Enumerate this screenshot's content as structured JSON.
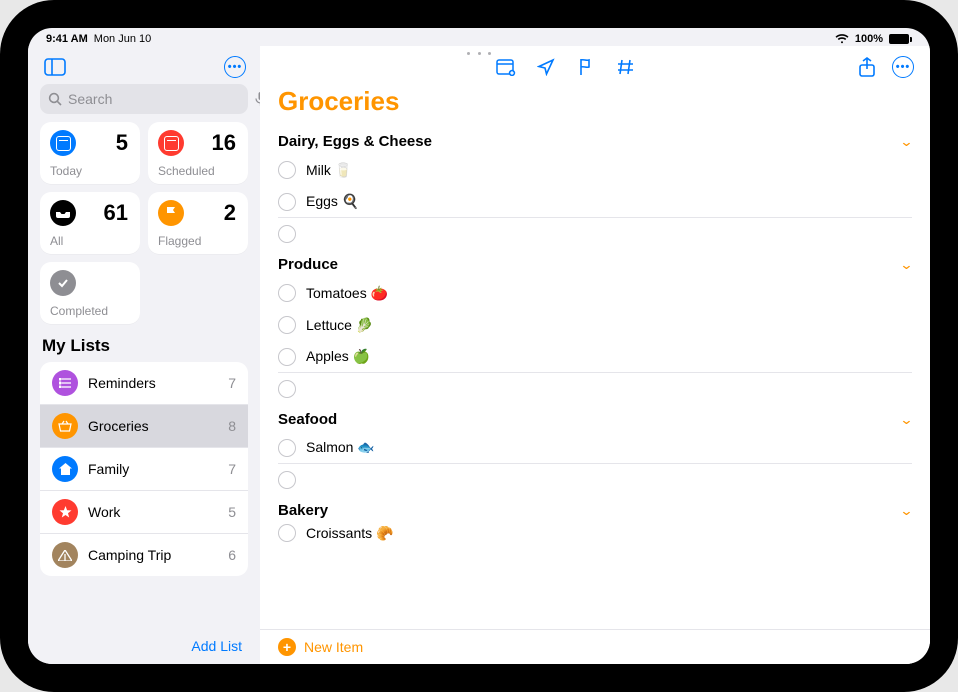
{
  "status": {
    "time": "9:41 AM",
    "date": "Mon Jun 10",
    "battery": "100%"
  },
  "search": {
    "placeholder": "Search"
  },
  "tiles": {
    "today": {
      "label": "Today",
      "count": "5"
    },
    "scheduled": {
      "label": "Scheduled",
      "count": "16"
    },
    "all": {
      "label": "All",
      "count": "61"
    },
    "flagged": {
      "label": "Flagged",
      "count": "2"
    },
    "completed": {
      "label": "Completed"
    }
  },
  "mylists_title": "My Lists",
  "lists": {
    "reminders": {
      "name": "Reminders",
      "count": "7"
    },
    "groceries": {
      "name": "Groceries",
      "count": "8"
    },
    "family": {
      "name": "Family",
      "count": "7"
    },
    "work": {
      "name": "Work",
      "count": "5"
    },
    "camping": {
      "name": "Camping Trip",
      "count": "6"
    }
  },
  "addlist": "Add List",
  "main": {
    "title": "Groceries",
    "newitem": "New Item",
    "sections": {
      "dairy": {
        "name": "Dairy, Eggs & Cheese",
        "items": {
          "milk": "Milk 🥛",
          "eggs": "Eggs 🍳"
        }
      },
      "produce": {
        "name": "Produce",
        "items": {
          "tomatoes": "Tomatoes 🍅",
          "lettuce": "Lettuce 🥬",
          "apples": "Apples 🍏"
        }
      },
      "seafood": {
        "name": "Seafood",
        "items": {
          "salmon": "Salmon 🐟"
        }
      },
      "bakery": {
        "name": "Bakery",
        "items": {
          "croissants": "Croissants 🥐"
        }
      }
    }
  }
}
